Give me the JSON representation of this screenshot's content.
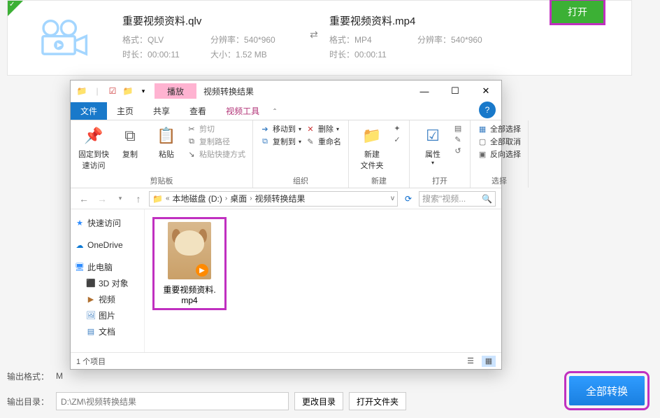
{
  "row": {
    "src": {
      "title": "重要视频资料.qlv",
      "fmt_lbl": "格式：",
      "fmt": "QLV",
      "res_lbl": "分辨率：",
      "res": "540*960",
      "dur_lbl": "时长：",
      "dur": "00:00:11",
      "size_lbl": "大小：",
      "size": "1.52 MB"
    },
    "dst": {
      "title": "重要视频资料.mp4",
      "fmt_lbl": "格式：",
      "fmt": "MP4",
      "res_lbl": "分辨率：",
      "res": "540*960",
      "dur_lbl": "时长：",
      "dur": "00:00:11"
    },
    "open": "打开"
  },
  "exp": {
    "play_ctx": "播放",
    "window_title": "视频转换结果",
    "tabs": {
      "file": "文件",
      "home": "主页",
      "share": "共享",
      "view": "查看",
      "video": "视频工具"
    },
    "ribbon": {
      "pin": "固定到快\n速访问",
      "copy": "复制",
      "paste": "粘贴",
      "cut": "剪切",
      "copypath": "复制路径",
      "pasteshortcut": "粘贴快捷方式",
      "moveto": "移动到",
      "copyto": "复制到",
      "delete": "删除",
      "rename": "重命名",
      "newfolder": "新建\n文件夹",
      "easyaccess": "轻松访问",
      "props": "属性",
      "open": "打开",
      "edit": "编辑",
      "history": "历史记录",
      "selall": "全部选择",
      "selnone": "全部取消",
      "selinv": "反向选择",
      "g_clip": "剪贴板",
      "g_org": "组织",
      "g_new": "新建",
      "g_open": "打开",
      "g_sel": "选择"
    },
    "addr": {
      "seg1": "本地磁盘 (D:)",
      "seg2": "桌面",
      "seg3": "视频转换结果"
    },
    "search_ph": "搜索\"视频...",
    "nav": {
      "quick": "快速访问",
      "onedrive": "OneDrive",
      "thispc": "此电脑",
      "obj3d": "3D 对象",
      "video": "视频",
      "pictures": "图片",
      "docs": "文档"
    },
    "file": {
      "name": "重要视频资料.\nmp4"
    },
    "status": "1 个项目"
  },
  "bottom": {
    "fmt_lbl": "输出格式：",
    "fmt_val": "M",
    "dir_lbl": "输出目录：",
    "dir_val": "D:\\ZM\\视频转换结果",
    "changedir": "更改目录",
    "openfolder": "打开文件夹",
    "convert": "全部转换"
  }
}
